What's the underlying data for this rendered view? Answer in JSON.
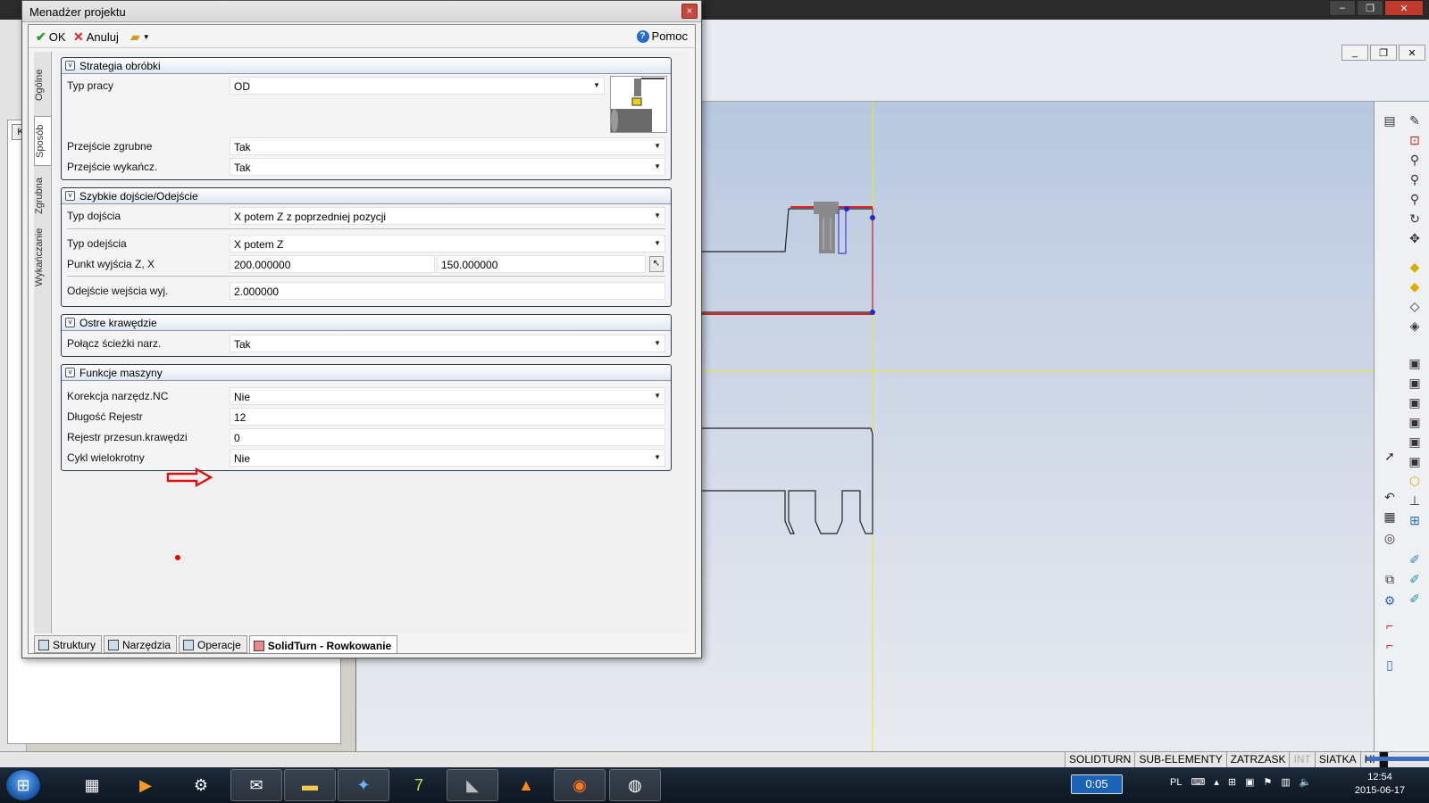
{
  "dialog": {
    "title": "Menadżer projektu",
    "close_glyph": "×",
    "toolbar": {
      "ok_label": "OK",
      "cancel_label": "Anuluj",
      "help_label": "Pomoc"
    },
    "side_tabs": [
      "Ogólne",
      "Sposób",
      "Zgrubna",
      "Wykańczanie"
    ],
    "sections": {
      "strategy": {
        "title": "Strategia obróbki",
        "fields": [
          {
            "label": "Typ pracy",
            "value": "OD"
          },
          {
            "label": "Przejście zgrubne",
            "value": "Tak"
          },
          {
            "label": "Przejście wykańcz.",
            "value": "Tak"
          }
        ]
      },
      "approach": {
        "title": "Szybkie dojście/Odejście",
        "fields": [
          {
            "label": "Typ dojścia",
            "value": "X potem Z z poprzedniej pozycji"
          },
          {
            "label": "Typ odejścia",
            "value": "X potem Z"
          },
          {
            "label": "Punkt wyjścia Z, X",
            "value": "200.000000",
            "value2": "150.000000"
          },
          {
            "label": "Odejście wejścia  wyj.",
            "value": "2.000000"
          }
        ]
      },
      "edges": {
        "title": "Ostre krawędzie",
        "fields": [
          {
            "label": "Połącz ścieżki narz.",
            "value": "Tak"
          }
        ]
      },
      "machine": {
        "title": "Funkcje maszyny",
        "fields": [
          {
            "label": "Korekcja narzędz.NC",
            "value": "Nie"
          },
          {
            "label": "Długość Rejestr",
            "value": "12"
          },
          {
            "label": "Rejestr przesun.krawędzi",
            "value": "0"
          },
          {
            "label": "Cykl wielokrotny",
            "value": "Nie"
          }
        ]
      }
    },
    "bottom_tabs": [
      "Struktury",
      "Narzędzia",
      "Operacje",
      "SolidTurn - Rowkowanie"
    ]
  },
  "left_panel": {
    "tab_label": "K"
  },
  "statusbar": {
    "items": [
      "SOLIDTURN",
      "SUB-ELEMENTY",
      "ZATRZASK",
      "INT",
      "SIATKA",
      "HI"
    ]
  },
  "taskbar": {
    "timer": "0:05",
    "language": "PL",
    "time": "12:54",
    "date": "2015-06-17"
  },
  "colors": {
    "accent": "#2a3a55",
    "toolpath": "#e02020",
    "axis": "#ffff00"
  },
  "icons": {
    "ok": "check-icon",
    "cancel": "x-icon",
    "folder": "folder-icon",
    "help": "help-icon",
    "arrow": "red-arrow-annotation"
  }
}
